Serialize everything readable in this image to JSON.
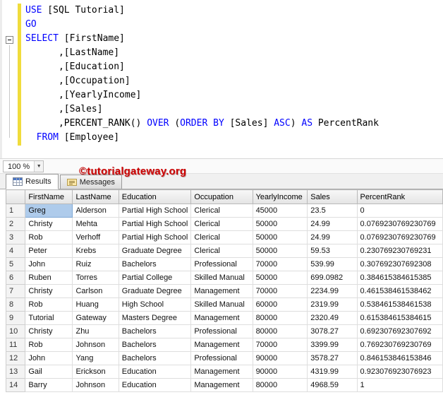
{
  "watermark": "©tutorialgateway.org",
  "colors": {
    "keyword": "#0000ff",
    "watermark": "#cc0000",
    "selected_cell": "#aecbeb",
    "change_bar": "#f0dc3c"
  },
  "editor": {
    "zoom_label": "100 %",
    "lines": [
      [
        {
          "t": "USE",
          "c": "k"
        },
        {
          "t": " [SQL Tutorial]",
          "c": "p"
        }
      ],
      [
        {
          "t": "GO",
          "c": "k"
        }
      ],
      [
        {
          "t": "SELECT",
          "c": "k"
        },
        {
          "t": " [FirstName]",
          "c": "p"
        }
      ],
      [
        {
          "t": "      ,[LastName]",
          "c": "p"
        }
      ],
      [
        {
          "t": "      ,[Education]",
          "c": "p"
        }
      ],
      [
        {
          "t": "      ,[Occupation]",
          "c": "p"
        }
      ],
      [
        {
          "t": "      ,[YearlyIncome]",
          "c": "p"
        }
      ],
      [
        {
          "t": "      ,[Sales]",
          "c": "p"
        }
      ],
      [
        {
          "t": "      ,PERCENT_RANK() ",
          "c": "p"
        },
        {
          "t": "OVER",
          "c": "k"
        },
        {
          "t": " (",
          "c": "p"
        },
        {
          "t": "ORDER BY",
          "c": "k"
        },
        {
          "t": " [Sales] ",
          "c": "p"
        },
        {
          "t": "ASC",
          "c": "k"
        },
        {
          "t": ") ",
          "c": "p"
        },
        {
          "t": "AS",
          "c": "k"
        },
        {
          "t": " PercentRank",
          "c": "p"
        }
      ],
      [
        {
          "t": "  ",
          "c": "p"
        },
        {
          "t": "FROM",
          "c": "k"
        },
        {
          "t": " [Employee]",
          "c": "p"
        }
      ]
    ]
  },
  "results": {
    "tabs": [
      {
        "label": "Results"
      },
      {
        "label": "Messages"
      }
    ]
  },
  "grid": {
    "columns": [
      "FirstName",
      "LastName",
      "Education",
      "Occupation",
      "YearlyIncome",
      "Sales",
      "PercentRank"
    ],
    "selected": {
      "row": 0,
      "col": 0
    },
    "rows": [
      [
        "1",
        "Greg",
        "Alderson",
        "Partial High School",
        "Clerical",
        "45000",
        "23.5",
        "0"
      ],
      [
        "2",
        "Christy",
        "Mehta",
        "Partial High School",
        "Clerical",
        "50000",
        "24.99",
        "0.0769230769230769"
      ],
      [
        "3",
        "Rob",
        "Verhoff",
        "Partial High School",
        "Clerical",
        "50000",
        "24.99",
        "0.0769230769230769"
      ],
      [
        "4",
        "Peter",
        "Krebs",
        "Graduate Degree",
        "Clerical",
        "50000",
        "59.53",
        "0.230769230769231"
      ],
      [
        "5",
        "John",
        "Ruiz",
        "Bachelors",
        "Professional",
        "70000",
        "539.99",
        "0.307692307692308"
      ],
      [
        "6",
        "Ruben",
        "Torres",
        "Partial College",
        "Skilled Manual",
        "50000",
        "699.0982",
        "0.384615384615385"
      ],
      [
        "7",
        "Christy",
        "Carlson",
        "Graduate Degree",
        "Management",
        "70000",
        "2234.99",
        "0.461538461538462"
      ],
      [
        "8",
        "Rob",
        "Huang",
        "High School",
        "Skilled Manual",
        "60000",
        "2319.99",
        "0.538461538461538"
      ],
      [
        "9",
        "Tutorial",
        "Gateway",
        "Masters Degree",
        "Management",
        "80000",
        "2320.49",
        "0.615384615384615"
      ],
      [
        "10",
        "Christy",
        "Zhu",
        "Bachelors",
        "Professional",
        "80000",
        "3078.27",
        "0.692307692307692"
      ],
      [
        "11",
        "Rob",
        "Johnson",
        "Bachelors",
        "Management",
        "70000",
        "3399.99",
        "0.769230769230769"
      ],
      [
        "12",
        "John",
        "Yang",
        "Bachelors",
        "Professional",
        "90000",
        "3578.27",
        "0.846153846153846"
      ],
      [
        "13",
        "Gail",
        "Erickson",
        "Education",
        "Management",
        "90000",
        "4319.99",
        "0.923076923076923"
      ],
      [
        "14",
        "Barry",
        "Johnson",
        "Education",
        "Management",
        "80000",
        "4968.59",
        "1"
      ]
    ]
  }
}
